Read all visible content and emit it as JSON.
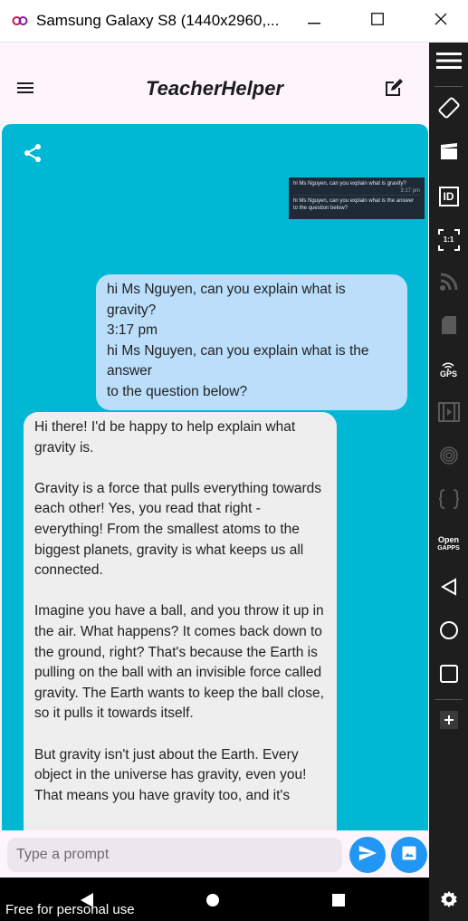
{
  "window": {
    "title": "Samsung Galaxy S8 (1440x2960,..."
  },
  "app": {
    "title": "TeacherHelper"
  },
  "thumbnail": {
    "line1": "hi Ms Nguyen, can you explain what is gravity?",
    "time": "3:17 pm",
    "line2": "hi Ms Nguyen, can you explain what is the answer",
    "line3": "to the question below?"
  },
  "messages": {
    "user": {
      "lines": [
        "hi Ms Nguyen, can you explain what is",
        "gravity?",
        "3:17 pm",
        "hi Ms Nguyen, can you explain what is the",
        "answer",
        "to the question below?"
      ]
    },
    "assistant": {
      "paragraphs": [
        "Hi there! I'd be happy to help explain what gravity is.",
        "Gravity is a force that pulls everything towards each other! Yes, you read that right - everything! From the smallest atoms to the biggest planets, gravity is what keeps us all connected.",
        "Imagine you have a ball, and you throw it up in the air. What happens? It comes back down to the ground, right? That's because the Earth is pulling on the ball with an invisible force called gravity. The Earth wants to keep the ball close, so it pulls it towards itself.",
        "But gravity isn't just about the Earth. Every object in the universe has gravity, even you! That means you have gravity too, and it's"
      ]
    }
  },
  "input": {
    "placeholder": "Type a prompt"
  },
  "watermark": "Free for personal use",
  "sidebar": {
    "gps_label": "GPS",
    "id_label": "ID",
    "ratio_label": "1:1",
    "open_gapps_label_1": "Open",
    "open_gapps_label_2": "GAPPS",
    "icons": [
      "menu-icon",
      "rotate-icon",
      "clapper-icon",
      "id-icon",
      "ratio-icon",
      "rss-icon",
      "sdcard-icon",
      "gps-icon",
      "film-icon",
      "fingerprint-icon",
      "braces-icon",
      "open-gapps-icon",
      "back-icon",
      "home-icon",
      "recents-icon",
      "plus-icon",
      "settings-icon"
    ]
  },
  "colors": {
    "chat_background": "#00b8d4",
    "user_bubble": "#bbdefb",
    "assistant_bubble": "#eeeeee",
    "accent": "#2196f3"
  }
}
